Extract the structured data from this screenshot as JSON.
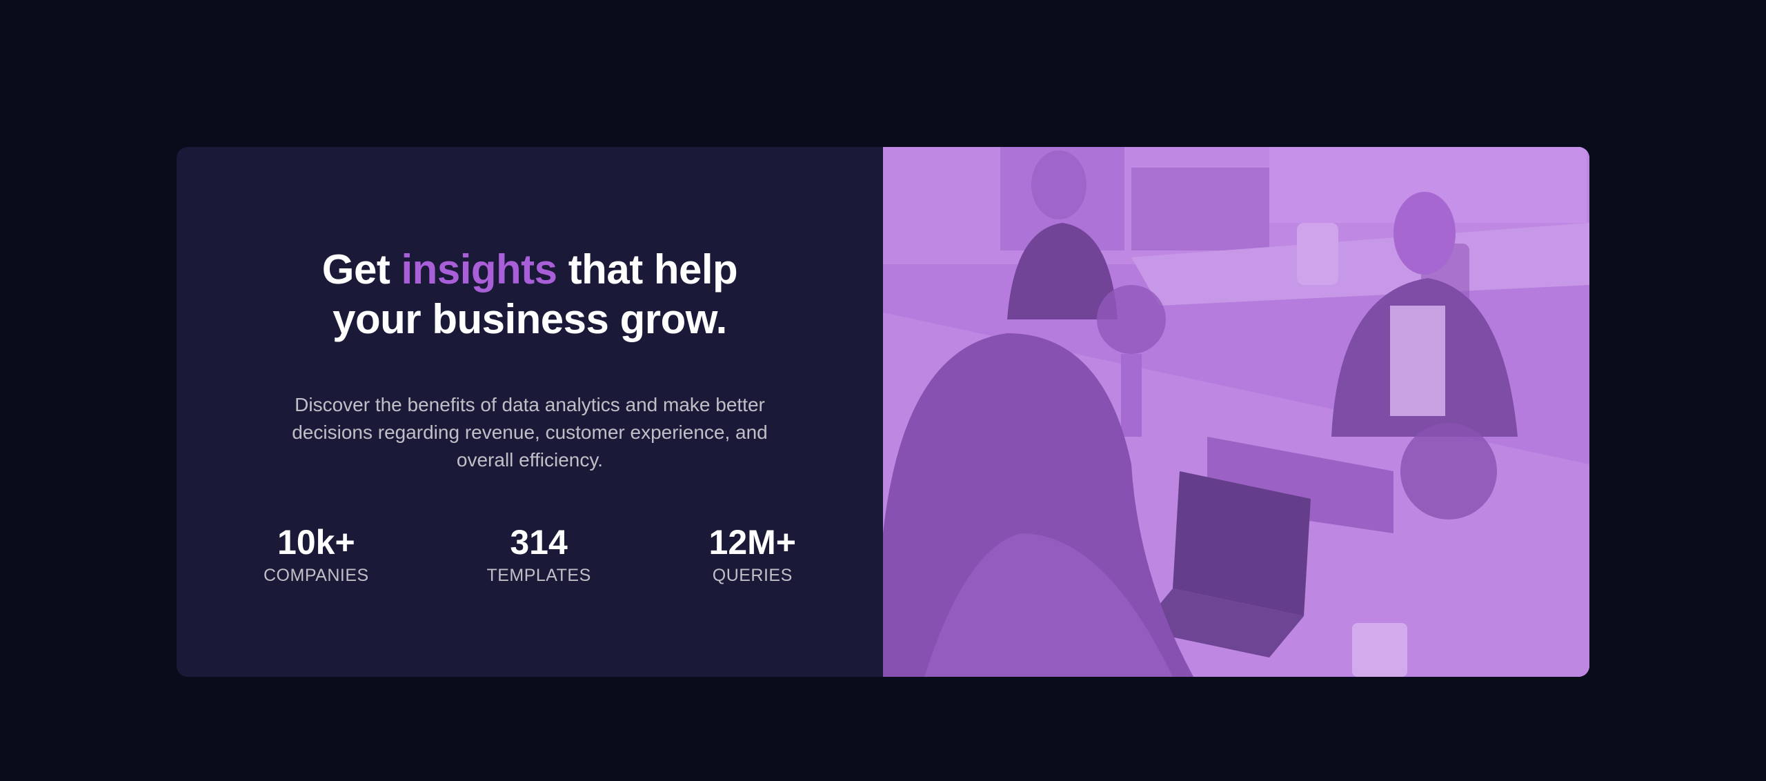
{
  "hero": {
    "headline_before": "Get",
    "headline_accent": "insights",
    "headline_after": "that help your business grow.",
    "description": "Discover the benefits of data analytics and make better decisions regarding revenue, customer experience, and overall efficiency."
  },
  "stats": [
    {
      "value": "10k+",
      "label": "COMPANIES"
    },
    {
      "value": "314",
      "label": "TEMPLATES"
    },
    {
      "value": "12M+",
      "label": "QUERIES"
    }
  ],
  "colors": {
    "background": "#090c1b",
    "card": "#1b1938",
    "accent": "#a95fd8",
    "photo_tint": "#aa5cdb"
  }
}
